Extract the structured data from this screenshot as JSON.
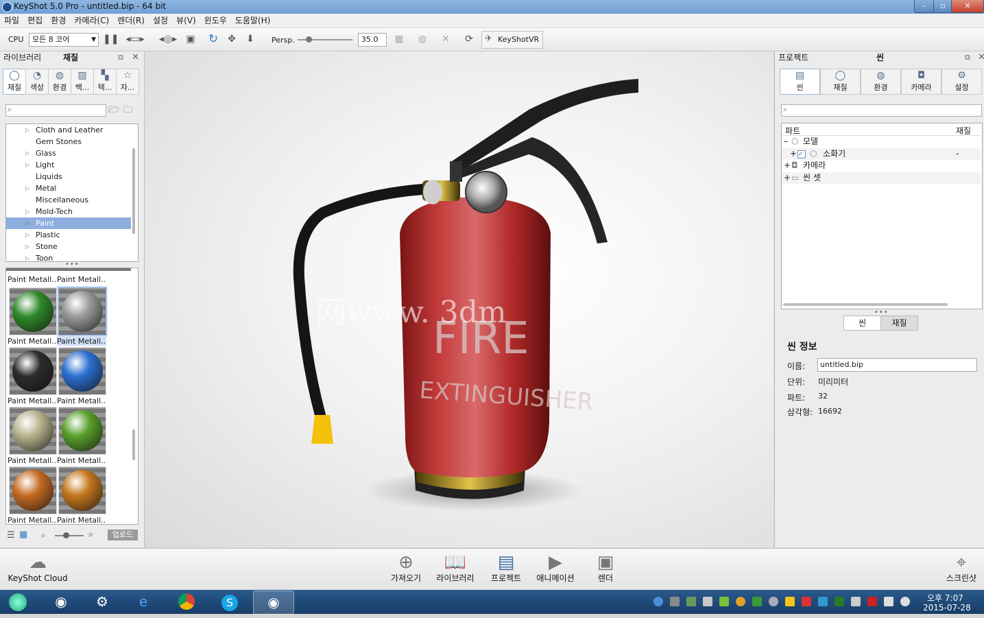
{
  "window": {
    "title": "KeyShot 5.0 Pro  - untitled.bip  - 64 bit",
    "min_label": "–",
    "max_label": "▫",
    "close_label": "✕"
  },
  "menu": [
    "파일",
    "편집",
    "환경",
    "카메라(C)",
    "렌더(R)",
    "설정",
    "뷰(V)",
    "윈도우",
    "도움말(H)"
  ],
  "toolbar": {
    "cpu_label": "CPU",
    "cpu_value": "모든 8 코어",
    "persp_label": "Persp.",
    "fov_value": "35.0",
    "keyshotvr_label": "KeyShotVR"
  },
  "library": {
    "title": "라이브러리",
    "subtitle": "재질",
    "tabs": [
      "재질",
      "색상",
      "환경",
      "백...",
      "텍...",
      "자..."
    ],
    "tab_icons": [
      "sphere-icon",
      "palette-icon",
      "globe-icon",
      "picture-icon",
      "texture-icon",
      "star-icon"
    ],
    "tree": [
      {
        "label": "Cloth and Leather",
        "arrow": true
      },
      {
        "label": "Gem Stones",
        "arrow": false
      },
      {
        "label": "Glass",
        "arrow": true
      },
      {
        "label": "Light",
        "arrow": true
      },
      {
        "label": "Liquids",
        "arrow": false
      },
      {
        "label": "Metal",
        "arrow": true
      },
      {
        "label": "Miscellaneous",
        "arrow": false
      },
      {
        "label": "Mold-Tech",
        "arrow": true
      },
      {
        "label": "Paint",
        "arrow": true,
        "selected": true
      },
      {
        "label": "Plastic",
        "arrow": true
      },
      {
        "label": "Stone",
        "arrow": true
      },
      {
        "label": "Toon",
        "arrow": true
      }
    ],
    "thumbnails": [
      {
        "label": "Paint Metall...",
        "color": "#2f8a2a"
      },
      {
        "label": "Paint Metall...",
        "color": "#9a9a9a",
        "selected": true
      },
      {
        "label": "Paint Metall...",
        "color": "#2b2b2b"
      },
      {
        "label": "Paint Metall...",
        "color": "#2a6fd1"
      },
      {
        "label": "Paint Metall...",
        "color": "#b7b38c"
      },
      {
        "label": "Paint Metall...",
        "color": "#5aa02a"
      },
      {
        "label": "Paint Metall...",
        "color": "#c56a22"
      },
      {
        "label": "Paint Metall...",
        "color": "#c4771d"
      }
    ],
    "top_labels": [
      "Paint Metall...",
      "Paint Metall..."
    ],
    "upload_label": "업로드"
  },
  "viewport": {
    "text_fire": "FIRE",
    "text_ext": "EXTINGUISHER",
    "watermark": "网www. 3dm"
  },
  "project": {
    "title": "프로젝트",
    "subtitle": "씬",
    "tabs": [
      "씬",
      "재질",
      "환경",
      "카메라",
      "설정"
    ],
    "tab_icons": [
      "list-icon",
      "sphere-icon",
      "globe-icon",
      "camera-icon",
      "gear-icon"
    ],
    "col_part": "파트",
    "col_material": "재질",
    "rows": [
      {
        "exp": "–",
        "label": "모델",
        "mat": ""
      },
      {
        "exp": "+",
        "label": "소화기",
        "mat": "-"
      },
      {
        "exp": "+",
        "label": "카메라",
        "mat": ""
      },
      {
        "exp": "+",
        "label": "씬 셋",
        "mat": ""
      }
    ],
    "subtabs": [
      "씬",
      "재질"
    ],
    "info_title": "씬 정보",
    "name_label": "이름:",
    "name_value": "untitled.bip",
    "unit_label": "단위:",
    "unit_value": "미리미터",
    "parts_label": "파트:",
    "parts_value": "32",
    "tris_label": "삼각형:",
    "tris_value": "16692"
  },
  "bottom": {
    "cloud_label": "KeyShot Cloud",
    "buttons": [
      "가져오기",
      "라이브러리",
      "프로젝트",
      "애니메이션",
      "렌더"
    ],
    "screenshot_label": "스크린샷"
  },
  "taskbar": {
    "time": "오후 7:07",
    "date": "2015-07-28"
  }
}
